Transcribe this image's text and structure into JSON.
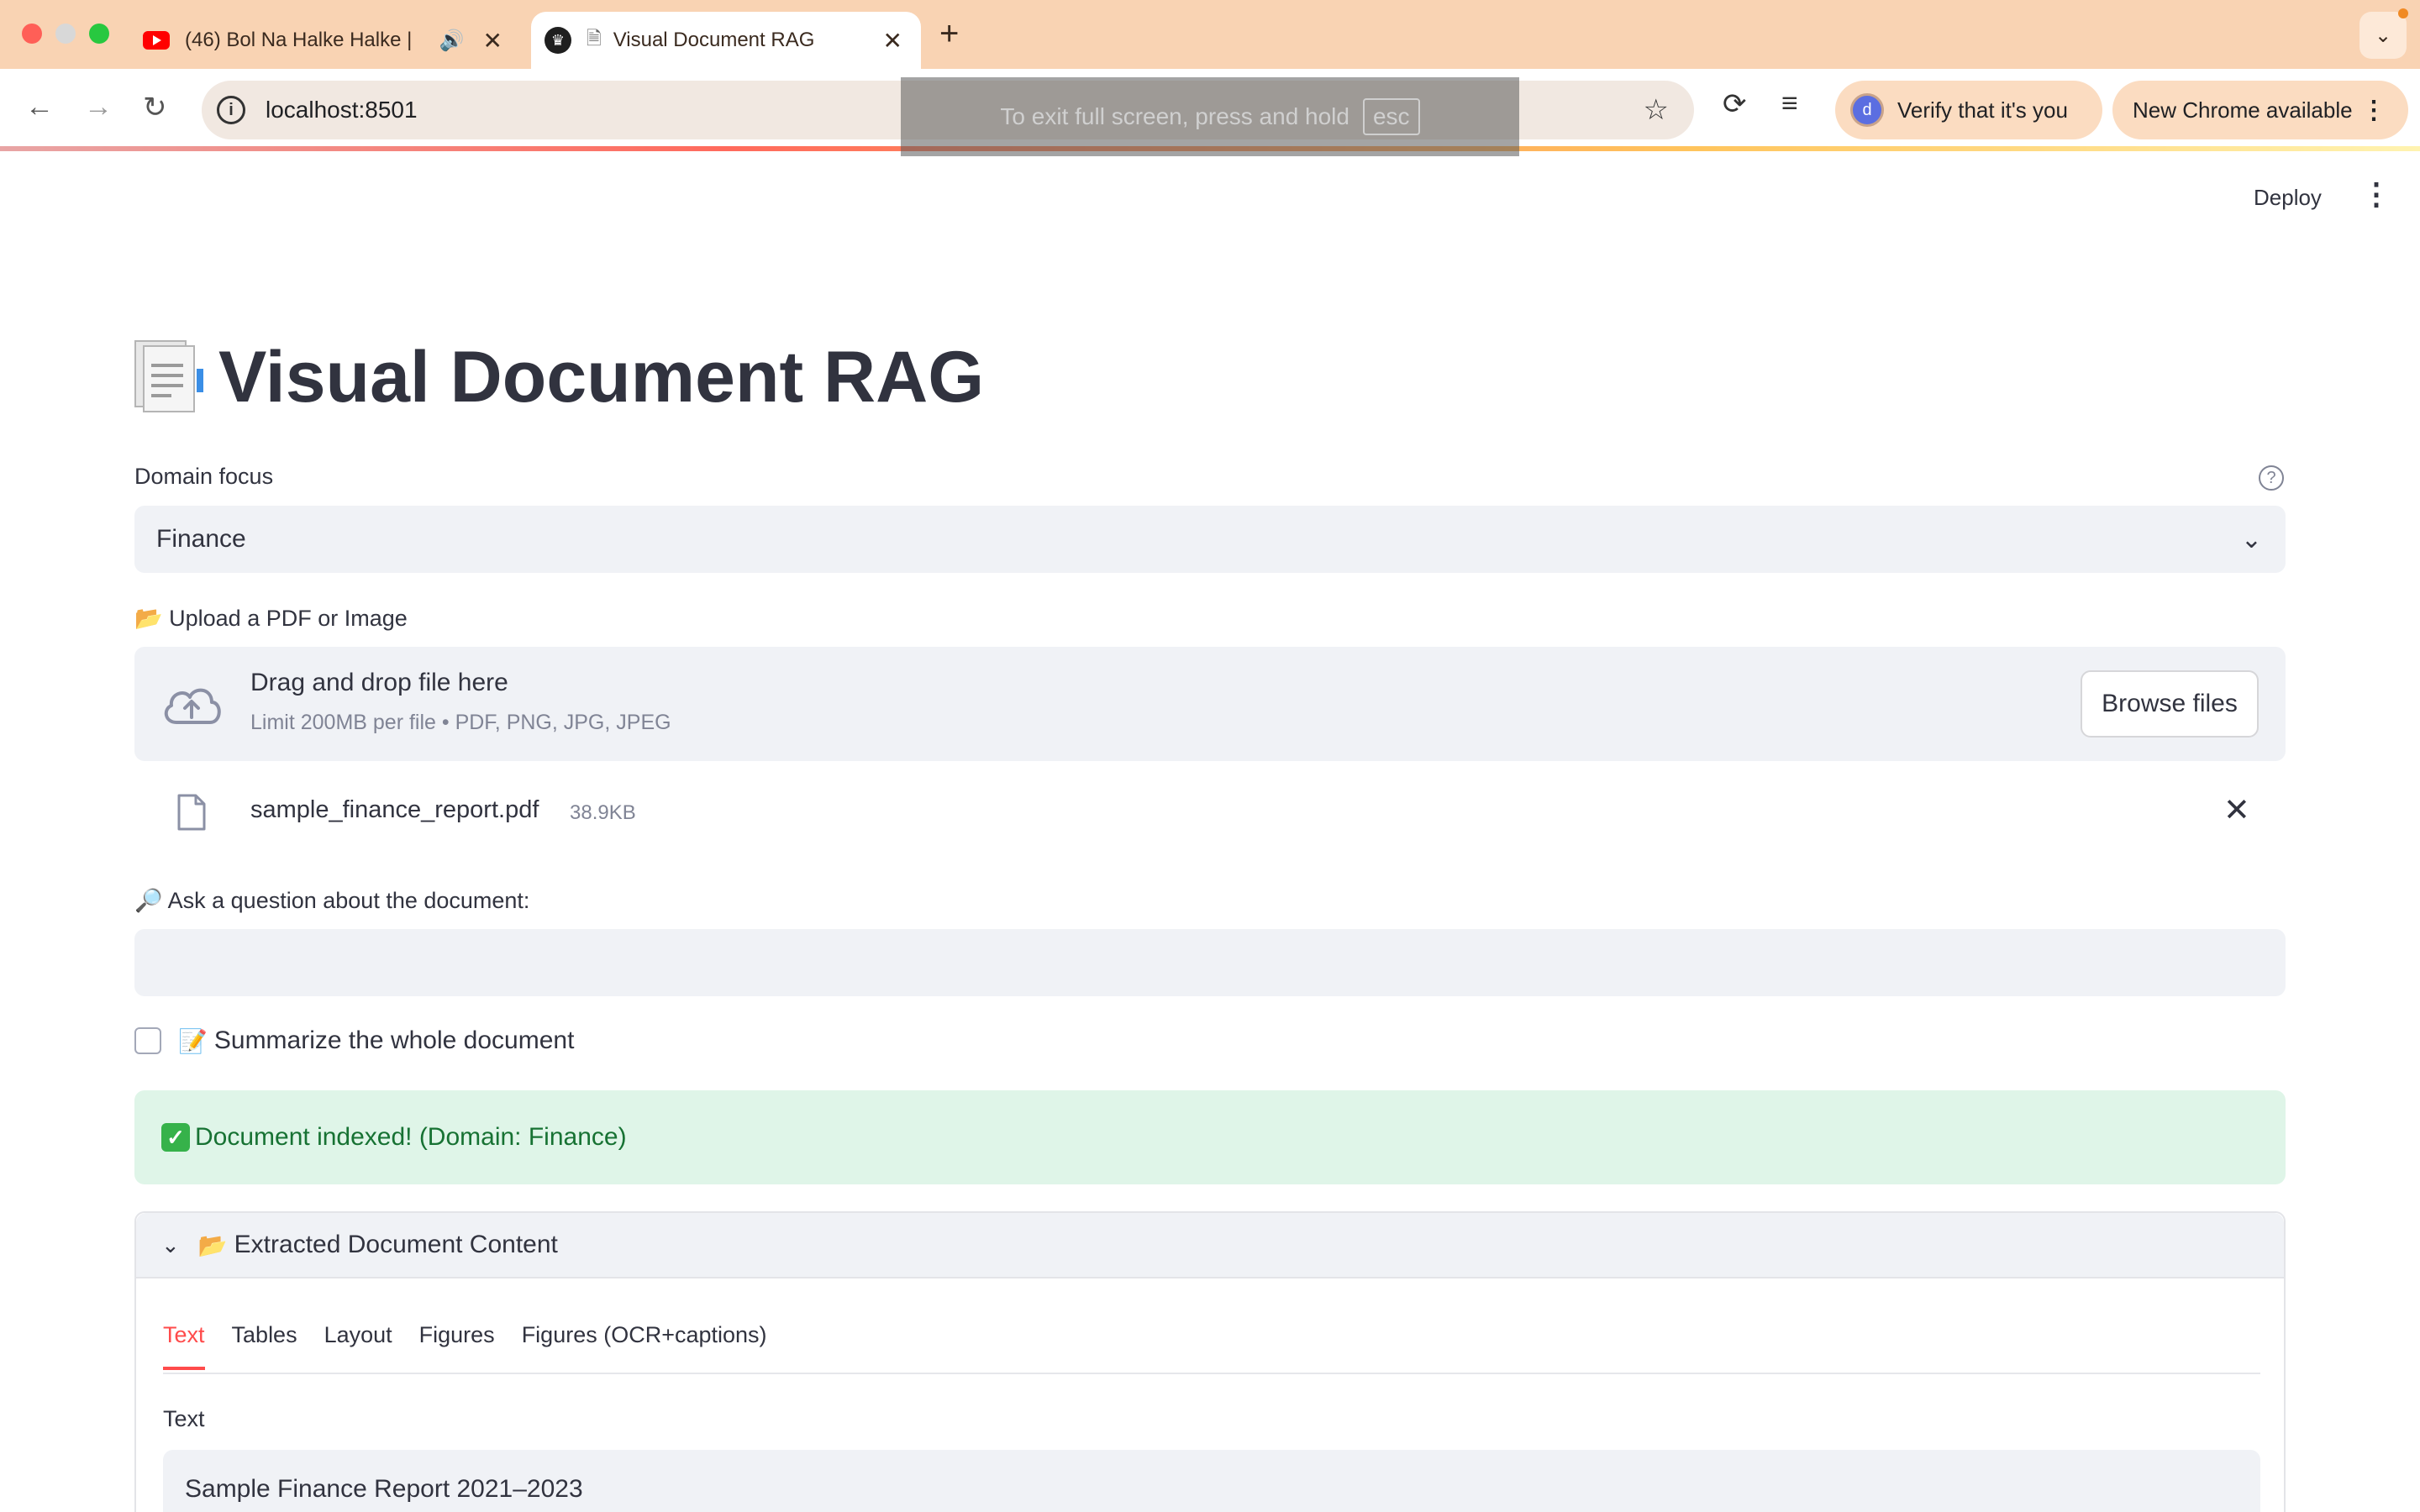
{
  "browser": {
    "tabs": [
      {
        "title": "(46) Bol Na Halke Halke | ",
        "active": false,
        "icon": "youtube-icon"
      },
      {
        "title": "Visual Document RAG",
        "active": true,
        "icon": "crown-icon"
      }
    ],
    "url": "localhost:8501",
    "fullscreen_notice": "To exit full screen, press and hold",
    "fullscreen_key": "esc",
    "verify_label": "Verify that it's you",
    "avatar_letter": "d",
    "new_chrome_label": "New Chrome available"
  },
  "app": {
    "deploy_label": "Deploy",
    "title": "Visual Document RAG",
    "domain_label": "Domain focus",
    "domain_value": "Finance",
    "upload_label": "Upload a PDF or Image",
    "drag_text": "Drag and drop file here",
    "limit_text": "Limit 200MB per file • PDF, PNG, JPG, JPEG",
    "browse_label": "Browse files",
    "file": {
      "name": "sample_finance_report.pdf",
      "size": "38.9KB"
    },
    "question_label": "Ask a question about the document:",
    "question_value": "",
    "summarize_label": "Summarize the whole document",
    "summarize_checked": false,
    "success_text": "Document indexed! (Domain: Finance)",
    "expander_title": "Extracted Document Content",
    "content_tabs": [
      "Text",
      "Tables",
      "Layout",
      "Figures",
      "Figures (OCR+captions)"
    ],
    "active_tab": "Text",
    "text_section_label": "Text",
    "text_preview": "Sample Finance Report 2021–2023"
  },
  "colors": {
    "accent": "#ff4b4b",
    "success_bg": "#dff5e8",
    "success_text": "#177233",
    "input_bg": "#f0f2f6"
  }
}
